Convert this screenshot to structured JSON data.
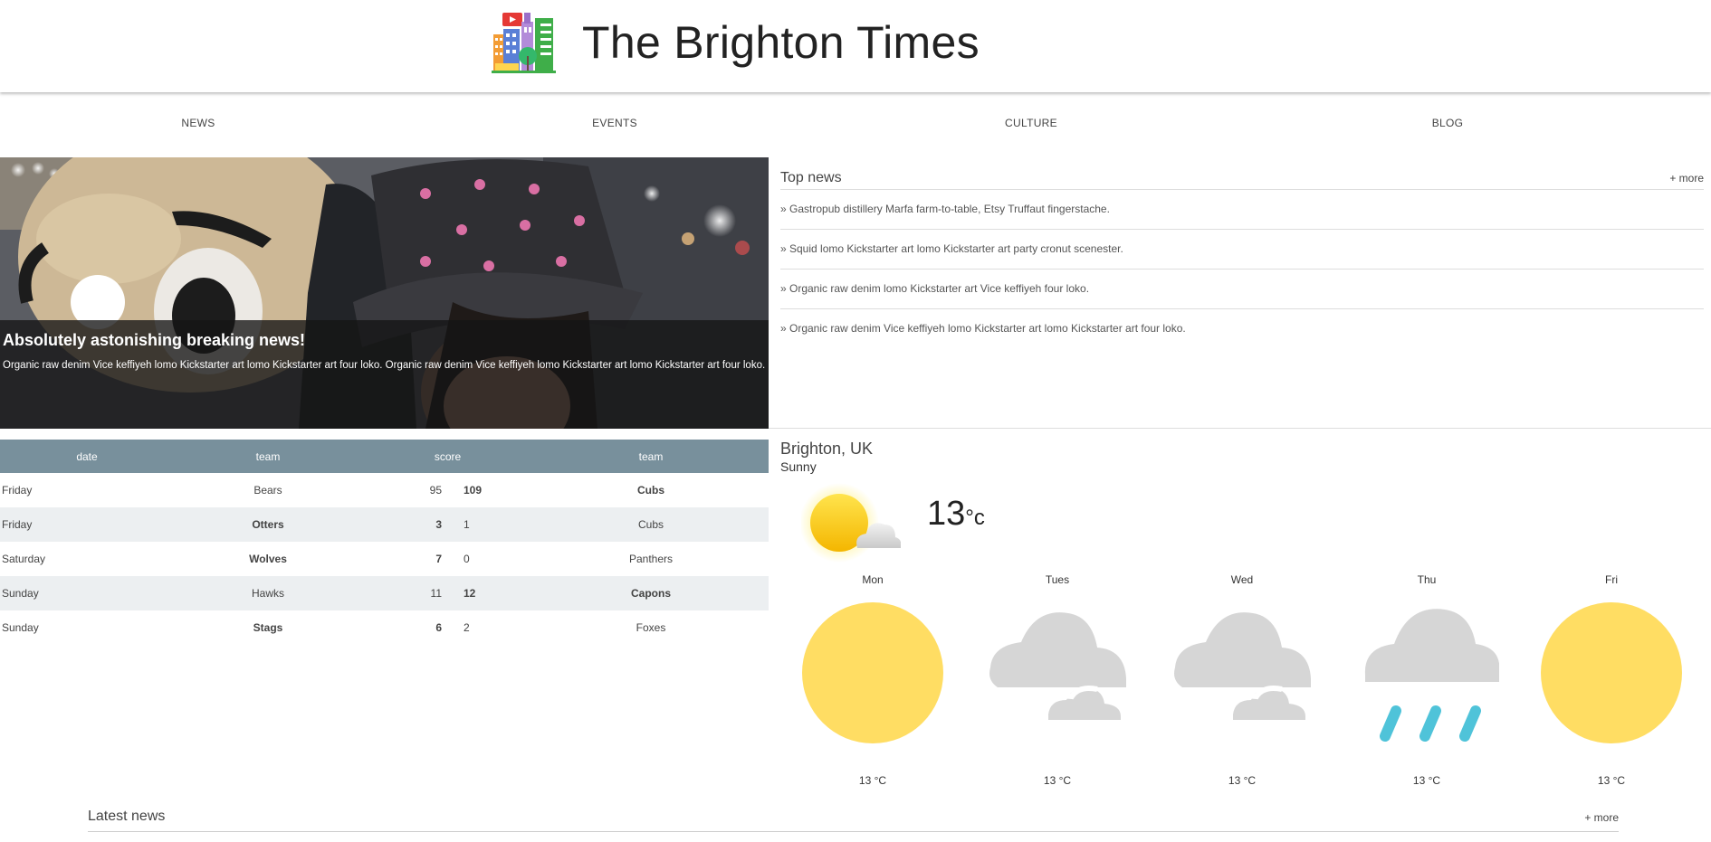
{
  "header": {
    "title": "The Brighton Times"
  },
  "nav": {
    "items": [
      "NEWS",
      "EVENTS",
      "CULTURE",
      "BLOG"
    ]
  },
  "hero": {
    "title": "Absolutely astonishing breaking news!",
    "body": "Organic raw denim Vice keffiyeh lomo Kickstarter art lomo Kickstarter art four loko. Organic raw denim Vice keffiyeh lomo Kickstarter art lomo Kickstarter art four loko."
  },
  "top_news": {
    "title": "Top news",
    "more": "+ more",
    "items": [
      "» Gastropub distillery Marfa farm-to-table, Etsy Truffaut fingerstache.",
      "» Squid lomo Kickstarter art lomo Kickstarter art party cronut scenester.",
      "» Organic raw denim lomo Kickstarter art Vice keffiyeh four loko.",
      "» Organic raw denim Vice keffiyeh lomo Kickstarter art lomo Kickstarter art four loko."
    ]
  },
  "scores": {
    "headers": [
      "date",
      "team",
      "score",
      "team"
    ],
    "rows": [
      {
        "date": "Friday",
        "team1": "Bears",
        "score1": "95",
        "score2": "109",
        "team2": "Cubs",
        "winner": 2
      },
      {
        "date": "Friday",
        "team1": "Otters",
        "score1": "3",
        "score2": "1",
        "team2": "Cubs",
        "winner": 1
      },
      {
        "date": "Saturday",
        "team1": "Wolves",
        "score1": "7",
        "score2": "0",
        "team2": "Panthers",
        "winner": 1
      },
      {
        "date": "Sunday",
        "team1": "Hawks",
        "score1": "11",
        "score2": "12",
        "team2": "Capons",
        "winner": 2
      },
      {
        "date": "Sunday",
        "team1": "Stags",
        "score1": "6",
        "score2": "2",
        "team2": "Foxes",
        "winner": 1
      }
    ]
  },
  "weather": {
    "city": "Brighton, UK",
    "condition": "Sunny",
    "temp": "13",
    "unit": "°c",
    "current_icon": "sun-behind-cloud-icon",
    "forecast": [
      {
        "day": "Mon",
        "icon": "sun-icon",
        "temp": "13 °C"
      },
      {
        "day": "Tues",
        "icon": "cloudy-icon",
        "temp": "13 °C"
      },
      {
        "day": "Wed",
        "icon": "cloudy-icon",
        "temp": "13 °C"
      },
      {
        "day": "Thu",
        "icon": "rain-icon",
        "temp": "13 °C"
      },
      {
        "day": "Fri",
        "icon": "sun-icon",
        "temp": "13 °C"
      }
    ]
  },
  "latest_news": {
    "title": "Latest news",
    "more": "+ more"
  },
  "colors": {
    "table_header": "#78909c",
    "row_alt": "#eceff1",
    "sun": "#ffdd63",
    "cloud": "#d6d6d6",
    "rain": "#4fc3d9"
  }
}
